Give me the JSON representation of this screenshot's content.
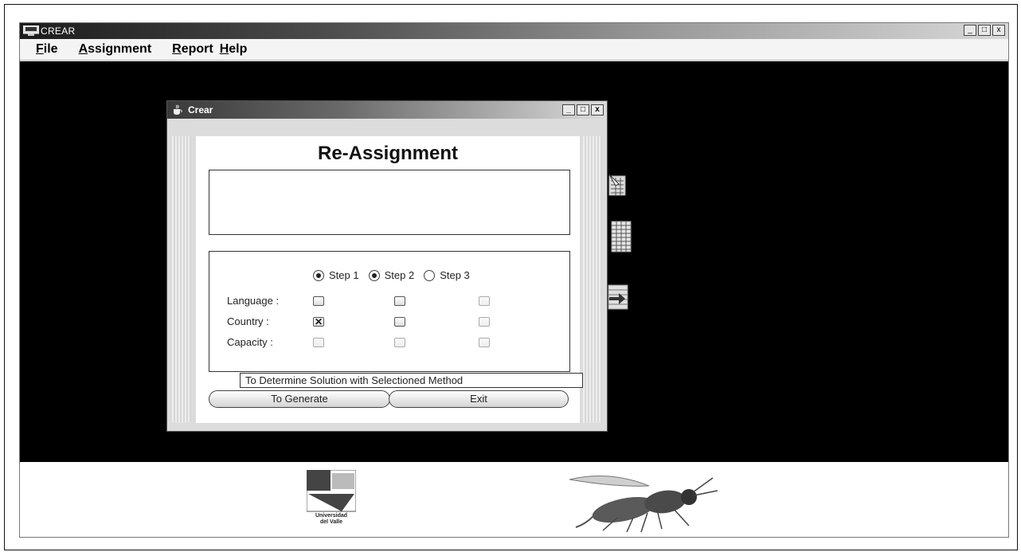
{
  "app": {
    "title": "CREAR",
    "window_buttons": {
      "minimize": "_",
      "maximize": "□",
      "close": "x"
    }
  },
  "menu": {
    "file": {
      "mnemonic": "F",
      "rest": "ile"
    },
    "assignment": {
      "mnemonic": "A",
      "rest": "ssignment"
    },
    "report": {
      "mnemonic": "R",
      "rest": "eport"
    },
    "help": {
      "mnemonic": "H",
      "rest": "elp"
    }
  },
  "dialog": {
    "title": "Crear",
    "window_buttons": {
      "minimize": "_",
      "maximize": "□",
      "close": "x"
    },
    "heading": "Re-Assignment",
    "steps": [
      {
        "label": "Step 1",
        "selected": true
      },
      {
        "label": "Step 2",
        "selected": true
      },
      {
        "label": "Step 3",
        "selected": false
      }
    ],
    "rows": [
      {
        "label": "Language :",
        "checks": [
          "",
          "",
          ""
        ]
      },
      {
        "label": "Country :",
        "checks": [
          "✕",
          "",
          ""
        ]
      },
      {
        "label": "Capacity :",
        "checks": [
          "",
          "",
          ""
        ]
      }
    ],
    "generate_button": "To Generate",
    "exit_button": "Exit",
    "tooltip": "To Determine Solution with Selectioned Method"
  },
  "footer": {
    "logo_line1": "Universidad",
    "logo_line2": "del Valle"
  },
  "icons": {
    "app": "window-app-icon",
    "dialog": "java-cup-icon",
    "side": [
      "spreadsheet-edit-icon",
      "table-grid-icon",
      "report-arrow-icon"
    ]
  }
}
